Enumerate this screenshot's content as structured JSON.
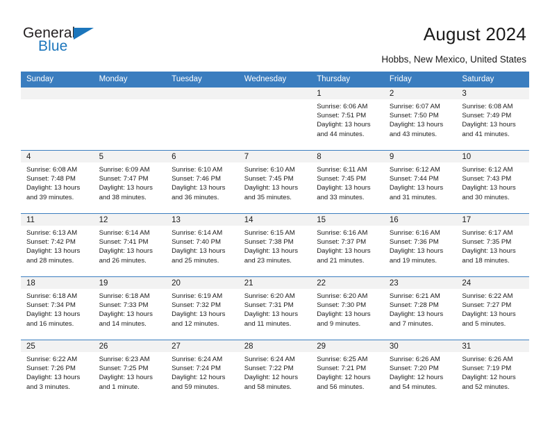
{
  "brand": {
    "word1": "General",
    "word2": "Blue",
    "triangle_color": "#1c76bc"
  },
  "header": {
    "title": "August 2024",
    "subtitle": "Hobbs, New Mexico, United States"
  },
  "theme": {
    "header_blue": "#3a7dbf",
    "daynum_bg": "#f2f2f2",
    "text": "#1a1a1a"
  },
  "weekday_headers": [
    "Sunday",
    "Monday",
    "Tuesday",
    "Wednesday",
    "Thursday",
    "Friday",
    "Saturday"
  ],
  "weeks": [
    [
      {
        "day": "",
        "empty": true,
        "sunrise": "",
        "sunset": "",
        "daylight1": "",
        "daylight2": ""
      },
      {
        "day": "",
        "empty": true,
        "sunrise": "",
        "sunset": "",
        "daylight1": "",
        "daylight2": ""
      },
      {
        "day": "",
        "empty": true,
        "sunrise": "",
        "sunset": "",
        "daylight1": "",
        "daylight2": ""
      },
      {
        "day": "",
        "empty": true,
        "sunrise": "",
        "sunset": "",
        "daylight1": "",
        "daylight2": ""
      },
      {
        "day": "1",
        "sunrise": "Sunrise: 6:06 AM",
        "sunset": "Sunset: 7:51 PM",
        "daylight1": "Daylight: 13 hours",
        "daylight2": "and 44 minutes."
      },
      {
        "day": "2",
        "sunrise": "Sunrise: 6:07 AM",
        "sunset": "Sunset: 7:50 PM",
        "daylight1": "Daylight: 13 hours",
        "daylight2": "and 43 minutes."
      },
      {
        "day": "3",
        "sunrise": "Sunrise: 6:08 AM",
        "sunset": "Sunset: 7:49 PM",
        "daylight1": "Daylight: 13 hours",
        "daylight2": "and 41 minutes."
      }
    ],
    [
      {
        "day": "4",
        "sunrise": "Sunrise: 6:08 AM",
        "sunset": "Sunset: 7:48 PM",
        "daylight1": "Daylight: 13 hours",
        "daylight2": "and 39 minutes."
      },
      {
        "day": "5",
        "sunrise": "Sunrise: 6:09 AM",
        "sunset": "Sunset: 7:47 PM",
        "daylight1": "Daylight: 13 hours",
        "daylight2": "and 38 minutes."
      },
      {
        "day": "6",
        "sunrise": "Sunrise: 6:10 AM",
        "sunset": "Sunset: 7:46 PM",
        "daylight1": "Daylight: 13 hours",
        "daylight2": "and 36 minutes."
      },
      {
        "day": "7",
        "sunrise": "Sunrise: 6:10 AM",
        "sunset": "Sunset: 7:45 PM",
        "daylight1": "Daylight: 13 hours",
        "daylight2": "and 35 minutes."
      },
      {
        "day": "8",
        "sunrise": "Sunrise: 6:11 AM",
        "sunset": "Sunset: 7:45 PM",
        "daylight1": "Daylight: 13 hours",
        "daylight2": "and 33 minutes."
      },
      {
        "day": "9",
        "sunrise": "Sunrise: 6:12 AM",
        "sunset": "Sunset: 7:44 PM",
        "daylight1": "Daylight: 13 hours",
        "daylight2": "and 31 minutes."
      },
      {
        "day": "10",
        "sunrise": "Sunrise: 6:12 AM",
        "sunset": "Sunset: 7:43 PM",
        "daylight1": "Daylight: 13 hours",
        "daylight2": "and 30 minutes."
      }
    ],
    [
      {
        "day": "11",
        "sunrise": "Sunrise: 6:13 AM",
        "sunset": "Sunset: 7:42 PM",
        "daylight1": "Daylight: 13 hours",
        "daylight2": "and 28 minutes."
      },
      {
        "day": "12",
        "sunrise": "Sunrise: 6:14 AM",
        "sunset": "Sunset: 7:41 PM",
        "daylight1": "Daylight: 13 hours",
        "daylight2": "and 26 minutes."
      },
      {
        "day": "13",
        "sunrise": "Sunrise: 6:14 AM",
        "sunset": "Sunset: 7:40 PM",
        "daylight1": "Daylight: 13 hours",
        "daylight2": "and 25 minutes."
      },
      {
        "day": "14",
        "sunrise": "Sunrise: 6:15 AM",
        "sunset": "Sunset: 7:38 PM",
        "daylight1": "Daylight: 13 hours",
        "daylight2": "and 23 minutes."
      },
      {
        "day": "15",
        "sunrise": "Sunrise: 6:16 AM",
        "sunset": "Sunset: 7:37 PM",
        "daylight1": "Daylight: 13 hours",
        "daylight2": "and 21 minutes."
      },
      {
        "day": "16",
        "sunrise": "Sunrise: 6:16 AM",
        "sunset": "Sunset: 7:36 PM",
        "daylight1": "Daylight: 13 hours",
        "daylight2": "and 19 minutes."
      },
      {
        "day": "17",
        "sunrise": "Sunrise: 6:17 AM",
        "sunset": "Sunset: 7:35 PM",
        "daylight1": "Daylight: 13 hours",
        "daylight2": "and 18 minutes."
      }
    ],
    [
      {
        "day": "18",
        "sunrise": "Sunrise: 6:18 AM",
        "sunset": "Sunset: 7:34 PM",
        "daylight1": "Daylight: 13 hours",
        "daylight2": "and 16 minutes."
      },
      {
        "day": "19",
        "sunrise": "Sunrise: 6:18 AM",
        "sunset": "Sunset: 7:33 PM",
        "daylight1": "Daylight: 13 hours",
        "daylight2": "and 14 minutes."
      },
      {
        "day": "20",
        "sunrise": "Sunrise: 6:19 AM",
        "sunset": "Sunset: 7:32 PM",
        "daylight1": "Daylight: 13 hours",
        "daylight2": "and 12 minutes."
      },
      {
        "day": "21",
        "sunrise": "Sunrise: 6:20 AM",
        "sunset": "Sunset: 7:31 PM",
        "daylight1": "Daylight: 13 hours",
        "daylight2": "and 11 minutes."
      },
      {
        "day": "22",
        "sunrise": "Sunrise: 6:20 AM",
        "sunset": "Sunset: 7:30 PM",
        "daylight1": "Daylight: 13 hours",
        "daylight2": "and 9 minutes."
      },
      {
        "day": "23",
        "sunrise": "Sunrise: 6:21 AM",
        "sunset": "Sunset: 7:28 PM",
        "daylight1": "Daylight: 13 hours",
        "daylight2": "and 7 minutes."
      },
      {
        "day": "24",
        "sunrise": "Sunrise: 6:22 AM",
        "sunset": "Sunset: 7:27 PM",
        "daylight1": "Daylight: 13 hours",
        "daylight2": "and 5 minutes."
      }
    ],
    [
      {
        "day": "25",
        "sunrise": "Sunrise: 6:22 AM",
        "sunset": "Sunset: 7:26 PM",
        "daylight1": "Daylight: 13 hours",
        "daylight2": "and 3 minutes."
      },
      {
        "day": "26",
        "sunrise": "Sunrise: 6:23 AM",
        "sunset": "Sunset: 7:25 PM",
        "daylight1": "Daylight: 13 hours",
        "daylight2": "and 1 minute."
      },
      {
        "day": "27",
        "sunrise": "Sunrise: 6:24 AM",
        "sunset": "Sunset: 7:24 PM",
        "daylight1": "Daylight: 12 hours",
        "daylight2": "and 59 minutes."
      },
      {
        "day": "28",
        "sunrise": "Sunrise: 6:24 AM",
        "sunset": "Sunset: 7:22 PM",
        "daylight1": "Daylight: 12 hours",
        "daylight2": "and 58 minutes."
      },
      {
        "day": "29",
        "sunrise": "Sunrise: 6:25 AM",
        "sunset": "Sunset: 7:21 PM",
        "daylight1": "Daylight: 12 hours",
        "daylight2": "and 56 minutes."
      },
      {
        "day": "30",
        "sunrise": "Sunrise: 6:26 AM",
        "sunset": "Sunset: 7:20 PM",
        "daylight1": "Daylight: 12 hours",
        "daylight2": "and 54 minutes."
      },
      {
        "day": "31",
        "sunrise": "Sunrise: 6:26 AM",
        "sunset": "Sunset: 7:19 PM",
        "daylight1": "Daylight: 12 hours",
        "daylight2": "and 52 minutes."
      }
    ]
  ]
}
